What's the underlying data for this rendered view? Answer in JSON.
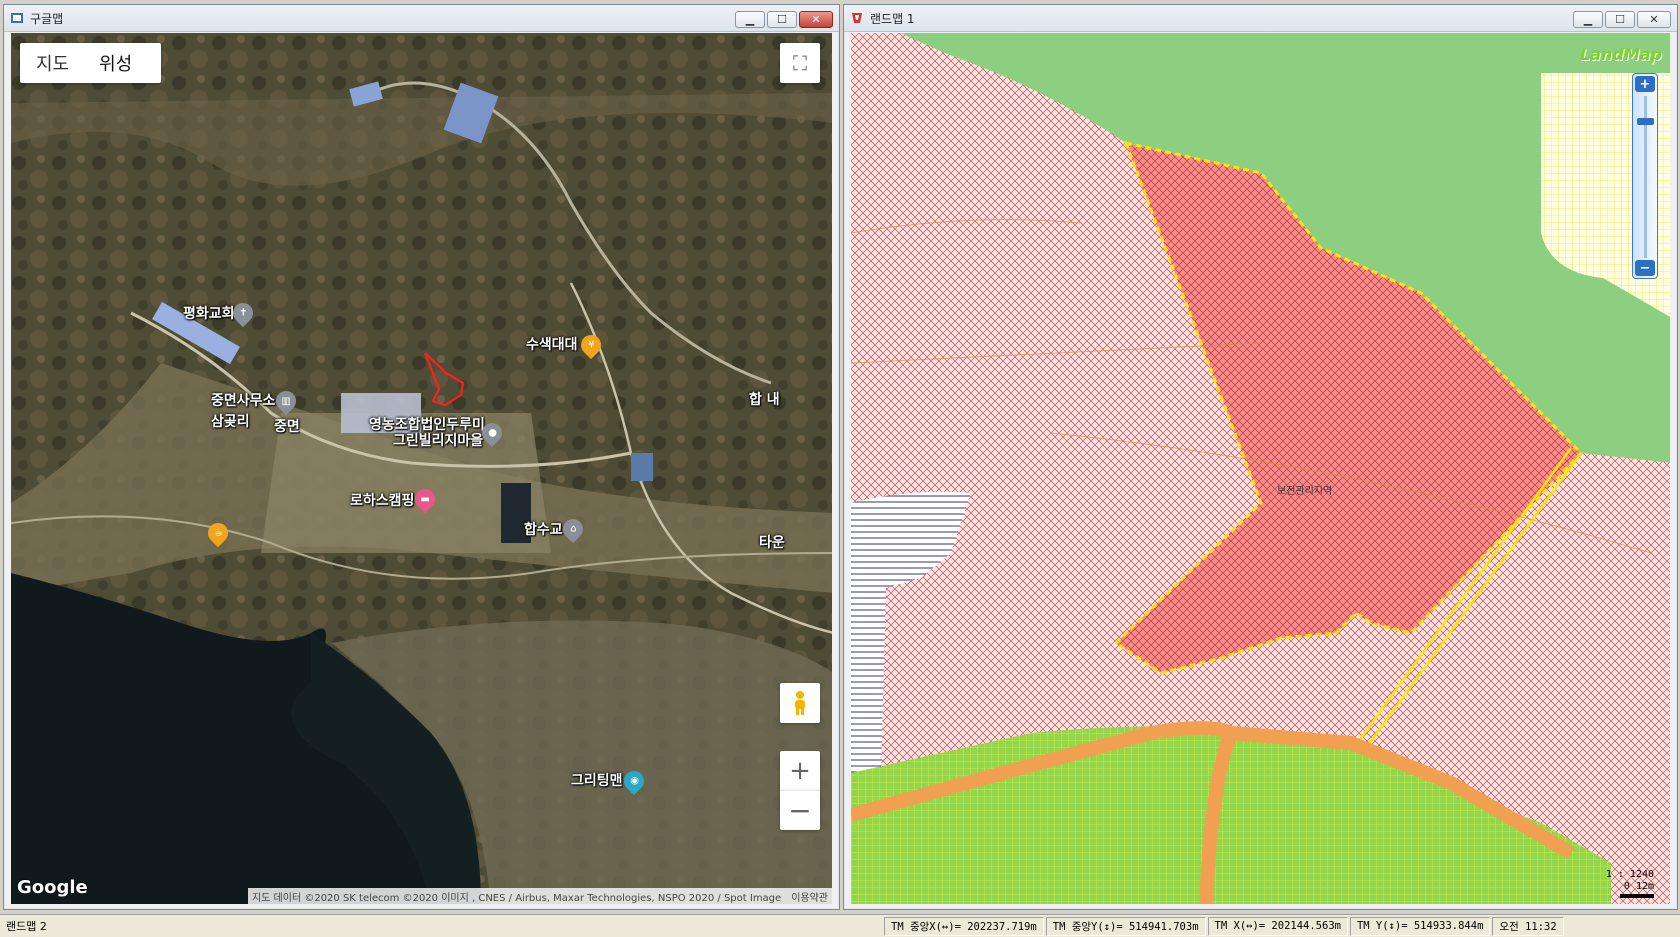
{
  "google_window": {
    "title": "구글맵",
    "maptype": {
      "map": "지도",
      "satellite": "위성"
    },
    "labels": [
      {
        "text": "평화교회"
      },
      {
        "text": "수색대대"
      },
      {
        "text": "중면사무소"
      },
      {
        "text": "삼곶리"
      },
      {
        "text": "중면"
      },
      {
        "text": "영농조합법인두루미"
      },
      {
        "text": "그린빌리지마을"
      },
      {
        "text": "합 내"
      },
      {
        "text": "로하스캠핑"
      },
      {
        "text": "합수교"
      },
      {
        "text": "타운"
      },
      {
        "text": "그리팅맨"
      }
    ],
    "logo": "Google",
    "attribution": "지도 데이터 ©2020 SK telecom ©2020 이미지 , CNES / Airbus, Maxar Technologies, NSPO 2020 / Spot Image",
    "terms": "이용약관",
    "zoom_in": "+",
    "zoom_out": "−",
    "fullscreen": "⛶"
  },
  "landmap_window": {
    "title": "랜드맵 1",
    "logo": "LandMap",
    "zone_label": "보전관리지역",
    "scale_ratio": "1 : 1240",
    "scale_origin": "0",
    "scale_length": "12m",
    "zoom_plus": "+",
    "zoom_minus": "−"
  },
  "window_buttons": {
    "minimize": "▁",
    "maximize": "☐",
    "close": "✕"
  },
  "statusbar": {
    "app": "랜드맵 2",
    "tm_center_x": "TM 중앙X(↔)= 202237.719m",
    "tm_center_y": "TM 중앙Y(↕)= 514941.703m",
    "tm_x": "TM X(↔)= 202144.563m",
    "tm_y": "TM Y(↕)= 514933.844m",
    "clock": "오전 11:32"
  },
  "colors": {
    "forest": "#8ccf80",
    "conservation_fill": "#f08c8c",
    "hatch": "#d23a3a",
    "highlight_border": "#ffe400",
    "farmland": "#9edb4f",
    "road": "#f0a050"
  }
}
